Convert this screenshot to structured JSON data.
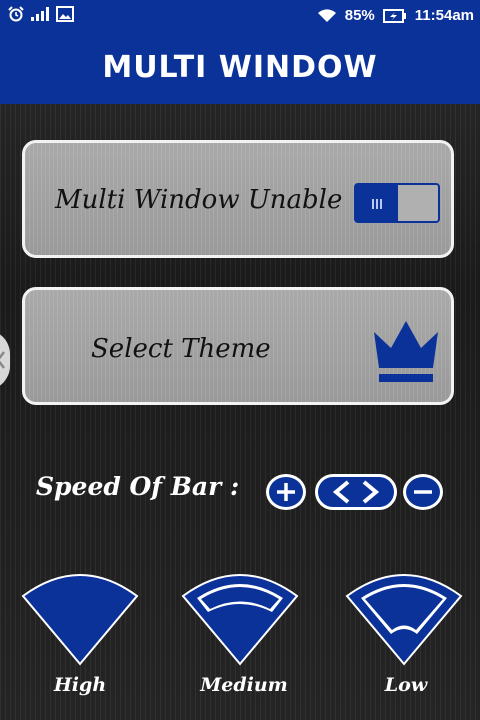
{
  "status_bar": {
    "battery": "85%",
    "time": "11:54am",
    "icons": [
      "alarm-icon",
      "signal-icon",
      "image-icon",
      "wifi-icon",
      "battery-charging-icon"
    ]
  },
  "app_bar": {
    "title": "MULTI WINDOW"
  },
  "multi_window_card": {
    "label": "Multi Window Unable",
    "toggle_on": true
  },
  "theme_card": {
    "label": "Select Theme",
    "icon": "crown-icon"
  },
  "speed": {
    "label": "Speed Of Bar :",
    "icons": [
      "plus-icon",
      "left-right-arrows-icon",
      "minus-icon"
    ]
  },
  "size_options": [
    {
      "label": "High",
      "icon": "filled-fan-icon"
    },
    {
      "label": "Medium",
      "icon": "outline-fan-icon"
    },
    {
      "label": "Low",
      "icon": "outline-fan-icon"
    }
  ],
  "colors": {
    "primary": "#0b3299",
    "card": "#a0a0a0",
    "text": "#ffffff"
  }
}
